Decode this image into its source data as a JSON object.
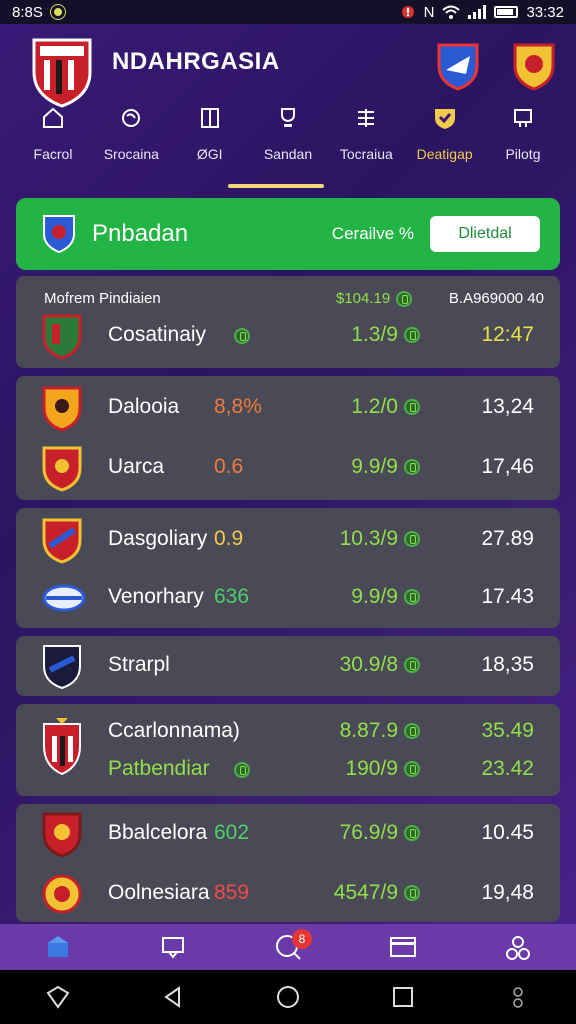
{
  "status_bar": {
    "left_text": "8:8S",
    "right_letter": "N",
    "time": "33:32"
  },
  "app": {
    "title": "NDAHRGASIA"
  },
  "nav": [
    {
      "label": "Facrol",
      "icon": "home-icon"
    },
    {
      "label": "Srocaina",
      "icon": "globe-icon"
    },
    {
      "label": "ØGI",
      "icon": "book-icon"
    },
    {
      "label": "Sandan",
      "icon": "trophy-icon"
    },
    {
      "label": "Tocraiua",
      "icon": "list-icon"
    },
    {
      "label": "Deatigap",
      "icon": "shield-icon"
    },
    {
      "label": "Pilotg",
      "icon": "chart-icon"
    }
  ],
  "banner": {
    "team": "Pnbadan",
    "rate": "Cerailve %",
    "button": "Dlietdal"
  },
  "header_row": {
    "label": "Mofrem Pindiaien",
    "odds": "$104.19",
    "total": "B.A969000 40"
  },
  "rows": [
    {
      "name": "Cosatinaiy",
      "pct": "",
      "odds": "1.3/9",
      "value": "12:47"
    },
    {
      "name": "Dalooia",
      "pct": "8,8%",
      "odds": "1.2/0",
      "value": "13,24"
    },
    {
      "name": "Uarca",
      "pct": "0.6",
      "odds": "9.9/9",
      "value": "17,46"
    },
    {
      "name": "Dasgoliary",
      "pct": "0.9",
      "odds": "10.3/9",
      "value": "27.89"
    },
    {
      "name": "Venorhary",
      "pct": "636",
      "odds": "9.9/9",
      "value": "17.43"
    },
    {
      "name": "Strarpl",
      "pct": "",
      "odds": "30.9/8",
      "value": "18,35"
    },
    {
      "name": "Ccarlonnama)",
      "pct": "",
      "odds": "8.87.9",
      "value": "35.49"
    },
    {
      "name": "Patbendiar",
      "pct": "",
      "odds": "190/9",
      "value": "23.42"
    },
    {
      "name": "Bbalcelora",
      "pct": "602",
      "odds": "76.9/9",
      "value": "10.45"
    },
    {
      "name": "Oolnesiara",
      "pct": "859",
      "odds": "4547/9",
      "value": "19,48"
    }
  ],
  "tabbar": {
    "badge": "8"
  },
  "colors": {
    "accent_green": "#22b444",
    "odds_green": "#8fe04a",
    "pct_orange": "#f07a3a",
    "pct_yellow": "#f2c94c",
    "tab_bg": "#6a3aa8"
  }
}
